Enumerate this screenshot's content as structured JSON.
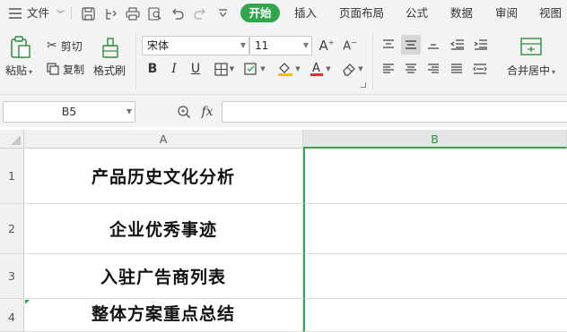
{
  "menubar": {
    "file_label": "文件",
    "tabs": [
      {
        "label": "开始",
        "active": true
      },
      {
        "label": "插入"
      },
      {
        "label": "页面布局"
      },
      {
        "label": "公式"
      },
      {
        "label": "数据"
      },
      {
        "label": "审阅"
      },
      {
        "label": "视图"
      }
    ]
  },
  "ribbon": {
    "paste_label": "粘贴",
    "cut_label": "剪切",
    "copy_label": "复制",
    "format_painter_label": "格式刷",
    "font_name": "宋体",
    "font_size": "11",
    "merge_label": "合并居中"
  },
  "formula_bar": {
    "name_box": "B5",
    "fx_label": "fx",
    "content": ""
  },
  "sheet": {
    "columns": [
      "A",
      "B"
    ],
    "selected_column": "B",
    "rows": [
      {
        "num": "1",
        "a": "产品历史文化分析",
        "b": ""
      },
      {
        "num": "2",
        "a": "企业优秀事迹",
        "b": ""
      },
      {
        "num": "3",
        "a": "入驻广告商列表",
        "b": ""
      },
      {
        "num": "4",
        "a": "整体方案重点总结",
        "b": ""
      }
    ]
  },
  "colors": {
    "accent_green": "#2fa64c",
    "font_color_bar": "#e03030",
    "fill_color_bar": "#f2c200"
  }
}
